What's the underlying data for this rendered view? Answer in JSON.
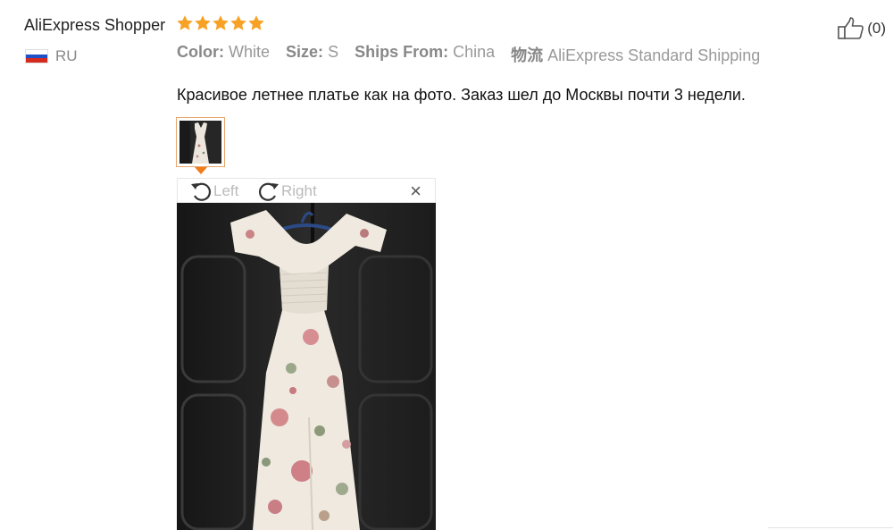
{
  "reviewer": {
    "name": "AliExpress Shopper",
    "country_code": "RU",
    "rating": 5
  },
  "colors": {
    "star": "#f7a224",
    "flag_white": "#ffffff",
    "flag_blue": "#1e50c8",
    "flag_red": "#d52b1e",
    "accent_border": "#e8a56b",
    "caret": "#f07c1a"
  },
  "like": {
    "icon": "thumbs-up-icon",
    "count": "(0)"
  },
  "attributes": [
    {
      "label": "Color:",
      "value": "White"
    },
    {
      "label": "Size:",
      "value": "S"
    },
    {
      "label": "Ships From:",
      "value": "China"
    },
    {
      "label": "物流",
      "value": "AliExpress Standard Shipping"
    }
  ],
  "review": {
    "text": "Красивое летнее платье как на фото. Заказ шел до Москвы почти 3 недели."
  },
  "viewer": {
    "rotate_left_label": "Left",
    "rotate_right_label": "Right",
    "close_symbol": "×"
  }
}
